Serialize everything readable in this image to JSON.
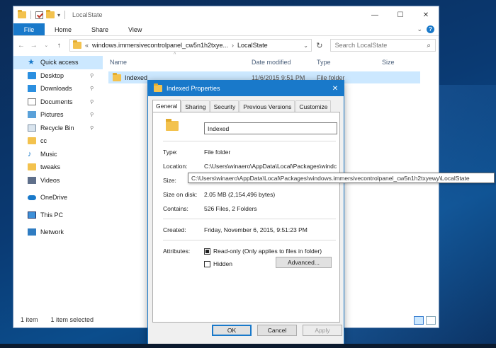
{
  "explorer": {
    "window_title": "LocalState",
    "window_controls": {
      "minimize": "—",
      "maximize": "☐",
      "close": "✕"
    },
    "ribbon": {
      "file_tab": "File",
      "tabs": [
        "Home",
        "Share",
        "View"
      ],
      "expand": "⌄",
      "help": "?"
    },
    "nav": {
      "back": "←",
      "forward": "→",
      "recent": "⌄",
      "up": "↑"
    },
    "address": {
      "chevrons": "«",
      "segments": [
        "windows.immersivecontrolpanel_cw5n1h2txye...",
        "LocalState"
      ],
      "separator": "›",
      "dropdown": "⌄"
    },
    "refresh": "↻",
    "search": {
      "placeholder": "Search LocalState",
      "icon": "⌕"
    },
    "sidebar": {
      "items": [
        {
          "label": "Quick access",
          "icon": "star-icon"
        },
        {
          "label": "Desktop",
          "icon": "desktop-icon",
          "pinned": true
        },
        {
          "label": "Downloads",
          "icon": "download-icon",
          "pinned": true
        },
        {
          "label": "Documents",
          "icon": "document-icon",
          "pinned": true
        },
        {
          "label": "Pictures",
          "icon": "pictures-icon",
          "pinned": true
        },
        {
          "label": "Recycle Bin",
          "icon": "recycle-bin-icon",
          "pinned": true
        },
        {
          "label": "cc",
          "icon": "folder-icon"
        },
        {
          "label": "Music",
          "icon": "music-icon"
        },
        {
          "label": "tweaks",
          "icon": "folder-icon"
        },
        {
          "label": "Videos",
          "icon": "video-icon"
        },
        {
          "label": "OneDrive",
          "icon": "onedrive-icon"
        },
        {
          "label": "This PC",
          "icon": "computer-icon"
        },
        {
          "label": "Network",
          "icon": "network-icon"
        }
      ],
      "pin_glyph": "📌"
    },
    "columns": [
      "Name",
      "Date modified",
      "Type",
      "Size"
    ],
    "sort_indicator": "^",
    "rows": [
      {
        "name": "Indexed",
        "date": "11/6/2015 9:51 PM",
        "type": "File folder",
        "size": ""
      }
    ],
    "status": {
      "count": "1 item",
      "selected": "1 item selected"
    }
  },
  "dialog": {
    "title": "Indexed Properties",
    "close": "✕",
    "tabs": [
      "General",
      "Sharing",
      "Security",
      "Previous Versions",
      "Customize"
    ],
    "name_value": "Indexed",
    "fields": {
      "type_label": "Type:",
      "type_value": "File folder",
      "location_label": "Location:",
      "location_value": "C:\\Users\\winaero\\AppData\\Local\\Packages\\windc",
      "size_label": "Size:",
      "size_on_disk_label": "Size on disk:",
      "size_on_disk_value": "2.05 MB (2,154,496 bytes)",
      "contains_label": "Contains:",
      "contains_value": "526 Files, 2 Folders",
      "created_label": "Created:",
      "created_value": "Friday, November 6, 2015, 9:51:23 PM",
      "attributes_label": "Attributes:",
      "readonly_label": "Read-only (Only applies to files in folder)",
      "hidden_label": "Hidden",
      "advanced_label": "Advanced..."
    },
    "buttons": {
      "ok": "OK",
      "cancel": "Cancel",
      "apply": "Apply"
    }
  },
  "tooltip": "C:\\Users\\winaero\\AppData\\Local\\Packages\\windows.immersivecontrolpanel_cw5n1h2txyewy\\LocalState",
  "colors": {
    "accent": "#1979ca",
    "selection": "#cce8ff",
    "folder": "#f3c24e"
  }
}
